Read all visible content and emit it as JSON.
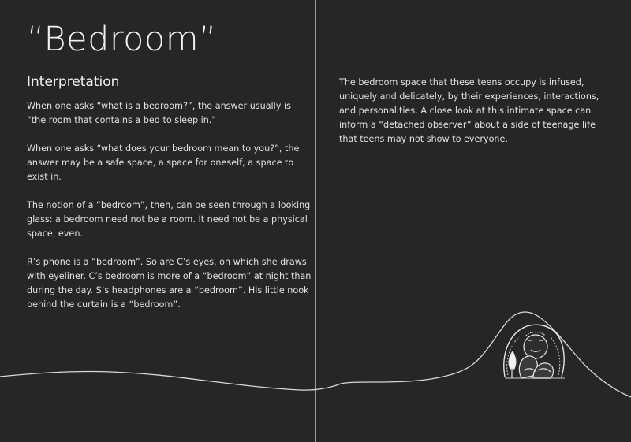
{
  "page": {
    "title": "“Bedroom”",
    "heading": "Interpretation",
    "left_paragraphs": [
      "When one asks “what is a bedroom?”, the answer usually is “the room that contains a bed to sleep in.”",
      "When one asks “what does your bedroom mean to you?”, the answer may be a safe space, a space for oneself, a space to exist in.",
      "The notion of a “bedroom”, then, can be seen through a looking glass: a bedroom need not be a room. It need not be a physical space, even.",
      "R’s phone is a “bedroom”. So are C’s eyes, on which she draws with eyeliner. C’s bedroom is more of a “bedroom” at night than during the day. S’s headphones are a “bedroom”. His little nook behind the curtain is a “bedroom”."
    ],
    "right_paragraphs": [
      "The bedroom space that these teens occupy is infused, uniquely and delicately, by their experiences, interactions, and personalities. A close look at this intimate space can inform a “detached observer” about a side of teenage life that teens may not show to everyone."
    ]
  },
  "colors": {
    "background": "#262626",
    "text": "#e2e2e2",
    "rule": "#9a9a9a"
  },
  "illustration": {
    "icon": "figure-in-mound-icon"
  }
}
